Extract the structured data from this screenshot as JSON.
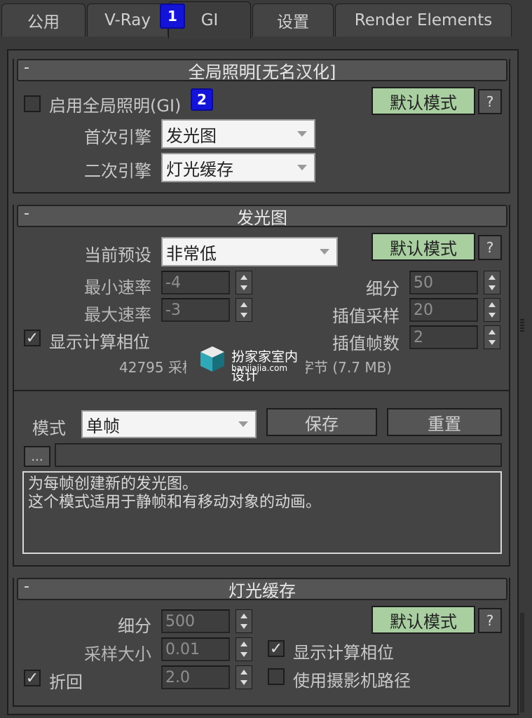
{
  "tabs": [
    {
      "label": "公用"
    },
    {
      "label": "V-Ray"
    },
    {
      "label": "GI"
    },
    {
      "label": "设置"
    },
    {
      "label": "Render Elements"
    }
  ],
  "badges": [
    "1",
    "2"
  ],
  "gi": {
    "header": "全局照明[无名汉化]",
    "collapse": "-",
    "enable_label": "启用全局照明(GI)",
    "mode_button": "默认模式",
    "help_button": "?",
    "primary_label": "首次引擎",
    "primary_value": "发光图",
    "secondary_label": "二次引擎",
    "secondary_value": "灯光缓存"
  },
  "irradiance": {
    "header": "发光图",
    "collapse": "-",
    "preset_label": "当前预设",
    "preset_value": "非常低",
    "mode_button": "默认模式",
    "help_button": "?",
    "min_rate_label": "最小速率",
    "min_rate": "-4",
    "max_rate_label": "最大速率",
    "max_rate": "-3",
    "subdivs_label": "细分",
    "subdivs": "50",
    "interp_samples_label": "插值采样",
    "interp_samples": "20",
    "interp_frames_label": "插值帧数",
    "interp_frames": "2",
    "show_calc_label": "显示计算相位",
    "show_calc_checked": "✓",
    "stats_left": "42795 采样",
    "stats_right": "字节 (7.7 MB)",
    "mode_label": "模式",
    "mode_value": "单帧",
    "save_button": "保存",
    "reset_button": "重置",
    "browse_button": "...",
    "description_line1": "为每帧创建新的发光图。",
    "description_line2": "这个模式适用于静帧和有移动对象的动画。"
  },
  "light_cache": {
    "header": "灯光缓存",
    "collapse": "-",
    "subdivs_label": "细分",
    "subdivs": "500",
    "sample_size_label": "采样大小",
    "sample_size": "0.01",
    "retrace_label": "折回",
    "retrace": "2.0",
    "retrace_checked": "✓",
    "mode_button": "默认模式",
    "help_button": "?",
    "show_calc_label": "显示计算相位",
    "show_calc_checked": "✓",
    "camera_path_label": "使用摄影机路径"
  },
  "watermark": {
    "title": "扮家家室内设计",
    "subtitle": "banjiajia.com"
  }
}
